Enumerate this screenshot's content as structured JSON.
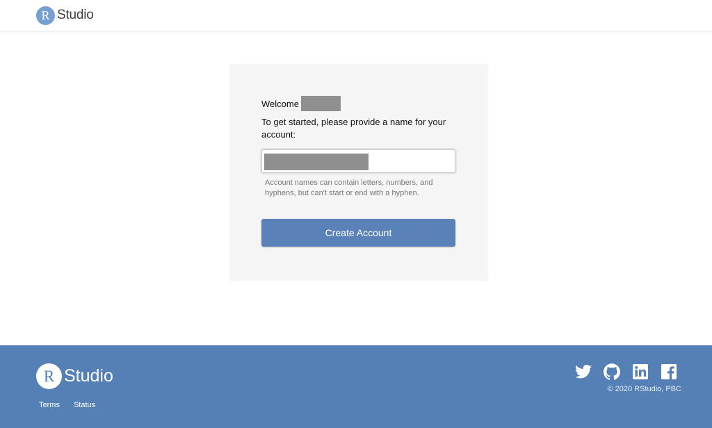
{
  "header": {
    "logo_letter": "R",
    "logo_text": "Studio"
  },
  "card": {
    "welcome_label": "Welcome",
    "intro_text": "To get started, please provide a name for your account:",
    "account_input": {
      "value": "",
      "placeholder": ""
    },
    "hint_text": "Account names can contain letters, numbers, and hyphens, but can't start or end with a hyphen.",
    "create_button_label": "Create Account"
  },
  "footer": {
    "logo_letter": "R",
    "logo_text": "Studio",
    "links": [
      {
        "label": "Terms"
      },
      {
        "label": "Status"
      }
    ],
    "social": [
      {
        "icon": "twitter-icon"
      },
      {
        "icon": "github-icon"
      },
      {
        "icon": "linkedin-icon"
      },
      {
        "icon": "facebook-icon"
      }
    ],
    "copyright": "© 2020 RStudio, PBC"
  },
  "colors": {
    "brand_blue": "#5580b6",
    "button_blue": "#5b82b8",
    "logo_circle": "#75a0d0",
    "card_bg": "#f5f5f5"
  }
}
